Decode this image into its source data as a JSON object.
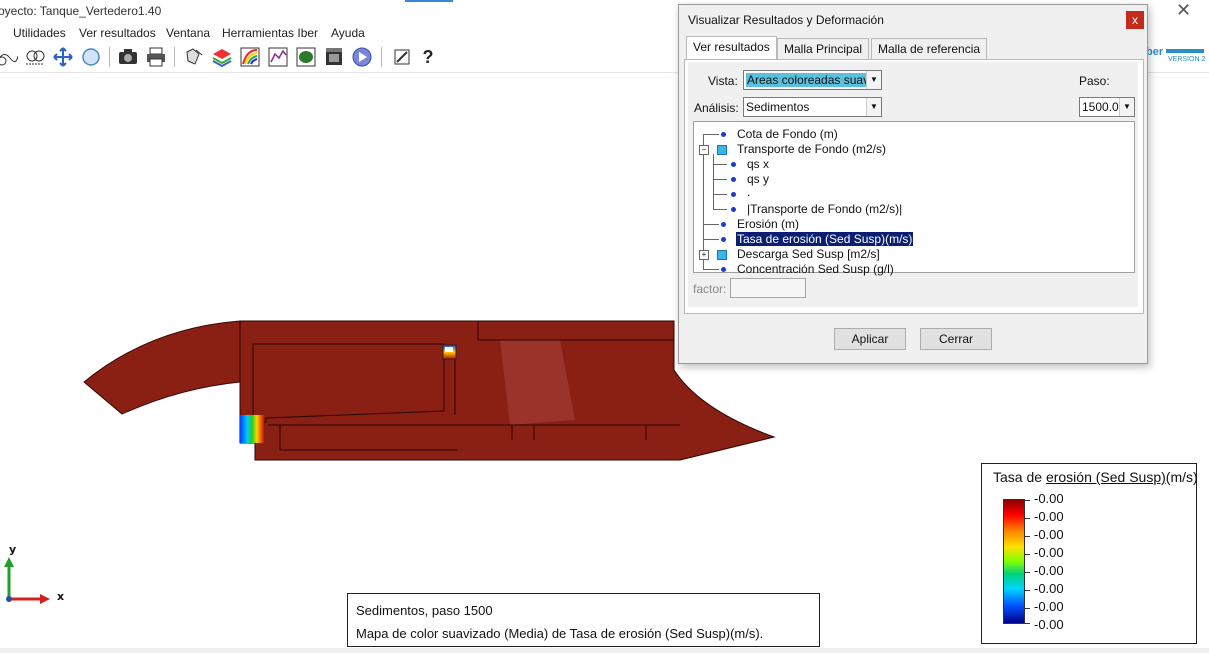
{
  "window": {
    "title": "oyecto: Tanque_Vertedero1.40",
    "close_glyph": "✕"
  },
  "menu": {
    "items": [
      "Utilidades",
      "Ver resultados",
      "Ventana",
      "Herramientas Iber",
      "Ayuda"
    ]
  },
  "toolbar": {
    "icons": [
      "mesh-view-icon",
      "mesh-contour-icon",
      "pan-icon",
      "sphere-icon",
      "camera-icon",
      "print-icon",
      "rotate-icon",
      "layers-icon",
      "rainbow-icon",
      "graph-icon",
      "surface-icon",
      "film-icon",
      "play-icon",
      "settings-icon",
      "help-icon"
    ],
    "help_glyph": "?"
  },
  "logo": {
    "text": "ber",
    "version": "VERSION 2"
  },
  "dialog": {
    "title": "Visualizar Resultados y Deformación",
    "close": "x",
    "tabs": [
      "Ver resultados",
      "Malla Principal",
      "Malla de referencia"
    ],
    "vista_label": "Vista:",
    "vista_value": "Areas coloreadas suave",
    "analisis_label": "Análisis:",
    "analisis_value": "Sedimentos",
    "paso_label": "Paso:",
    "paso_value": "1500.0",
    "results_tree": [
      "Cota de Fondo (m)",
      "Transporte de Fondo (m2/s)",
      "qs x",
      "qs y",
      ".",
      "|Transporte de Fondo (m2/s)|",
      "Erosión (m)",
      "Tasa de erosión (Sed Susp)(m/s)",
      "Descarga Sed Susp [m2/s]",
      "Concentración Sed Susp (g/l)"
    ],
    "factor_label": "factor:",
    "factor_value": "",
    "apply_label": "Aplicar",
    "close_label": "Cerrar"
  },
  "legend": {
    "title_pre": "Tasa de ",
    "title_u": "erosión (Sed Susp)",
    "title_post": "(m/s)",
    "values": [
      "-0.00",
      "-0.00",
      "-0.00",
      "-0.00",
      "-0.00",
      "-0.00",
      "-0.00",
      "-0.00"
    ],
    "colors": [
      "#8b0000",
      "#ff0000",
      "#ffe000",
      "#00d27a",
      "#0050ff",
      "#00008b"
    ]
  },
  "status": {
    "line1": "Sedimentos, paso 1500",
    "line2": "Mapa de color suavizado (Media) de Tasa de erosión (Sed Susp)(m/s)."
  },
  "axes": {
    "x": "x",
    "y": "y"
  },
  "domain_fill_color": "#8a1f14"
}
